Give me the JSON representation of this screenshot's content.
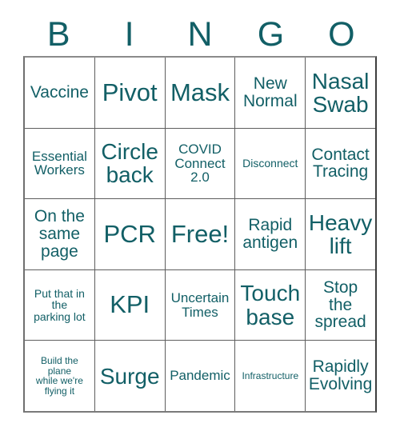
{
  "card": {
    "title": "Bingo Card",
    "accent_color": "#125f66",
    "grid_line_color": "#5e5e5e",
    "cell_background": "#ffffff",
    "page_background": "#ffffff",
    "columns": 5,
    "rows": 5
  },
  "header": {
    "letters": [
      {
        "label": "B"
      },
      {
        "label": "I"
      },
      {
        "label": "N"
      },
      {
        "label": "G"
      },
      {
        "label": "O"
      }
    ]
  },
  "grid": {
    "rows": [
      {
        "cells": [
          {
            "label": "Vaccine",
            "size": "md",
            "free": false
          },
          {
            "label": "Pivot",
            "size": "xl",
            "free": false
          },
          {
            "label": "Mask",
            "size": "xl",
            "free": false
          },
          {
            "label": "New\nNormal",
            "size": "md",
            "free": false
          },
          {
            "label": "Nasal\nSwab",
            "size": "lg",
            "free": false
          }
        ]
      },
      {
        "cells": [
          {
            "label": "Essential\nWorkers",
            "size": "sm",
            "free": false
          },
          {
            "label": "Circle\nback",
            "size": "lg",
            "free": false
          },
          {
            "label": "COVID\nConnect\n2.0",
            "size": "sm",
            "free": false
          },
          {
            "label": "Disconnect",
            "size": "xs",
            "free": false
          },
          {
            "label": "Contact\nTracing",
            "size": "md",
            "free": false
          }
        ]
      },
      {
        "cells": [
          {
            "label": "On the\nsame\npage",
            "size": "md",
            "free": false
          },
          {
            "label": "PCR",
            "size": "xl",
            "free": false
          },
          {
            "label": "Free!",
            "size": "xl",
            "free": true
          },
          {
            "label": "Rapid\nantigen",
            "size": "md",
            "free": false
          },
          {
            "label": "Heavy\nlift",
            "size": "lg",
            "free": false
          }
        ]
      },
      {
        "cells": [
          {
            "label": "Put that in\nthe\nparking lot",
            "size": "xs",
            "free": false
          },
          {
            "label": "KPI",
            "size": "xl",
            "free": false
          },
          {
            "label": "Uncertain\nTimes",
            "size": "sm",
            "free": false
          },
          {
            "label": "Touch\nbase",
            "size": "lg",
            "free": false
          },
          {
            "label": "Stop\nthe\nspread",
            "size": "md",
            "free": false
          }
        ]
      },
      {
        "cells": [
          {
            "label": "Build the\nplane\nwhile we're\nflying it",
            "size": "xxs",
            "free": false
          },
          {
            "label": "Surge",
            "size": "lg",
            "free": false
          },
          {
            "label": "Pandemic",
            "size": "sm",
            "free": false
          },
          {
            "label": "Infrastructure",
            "size": "xxs",
            "free": false
          },
          {
            "label": "Rapidly\nEvolving",
            "size": "md",
            "free": false
          }
        ]
      }
    ]
  }
}
